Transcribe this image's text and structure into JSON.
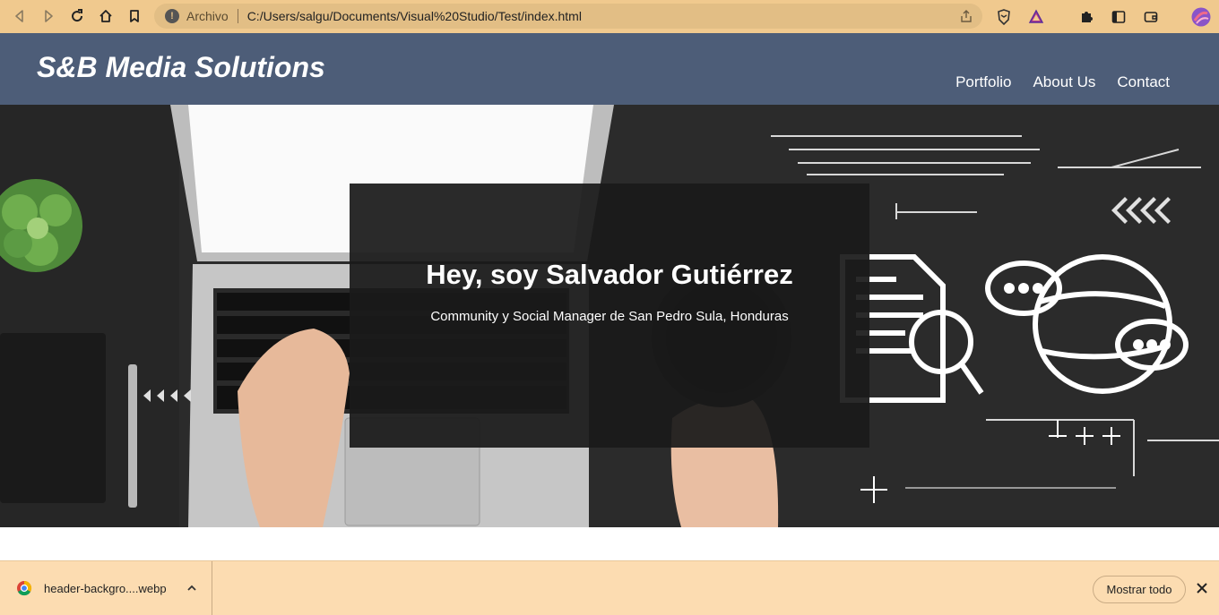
{
  "browser": {
    "url_scheme_label": "Archivo",
    "url": "C:/Users/salgu/Documents/Visual%20Studio/Test/index.html",
    "toolbar_color": "#f0c98e"
  },
  "site": {
    "brand": "S&B Media Solutions",
    "nav": [
      "Portfolio",
      "About Us",
      "Contact"
    ],
    "header_color": "#4d5d78"
  },
  "hero": {
    "title": "Hey, soy Salvador Gutiérrez",
    "subtitle": "Community y Social Manager de San Pedro Sula, Honduras"
  },
  "downloads": {
    "file_name": "header-backgro....webp",
    "show_all_label": "Mostrar todo"
  }
}
